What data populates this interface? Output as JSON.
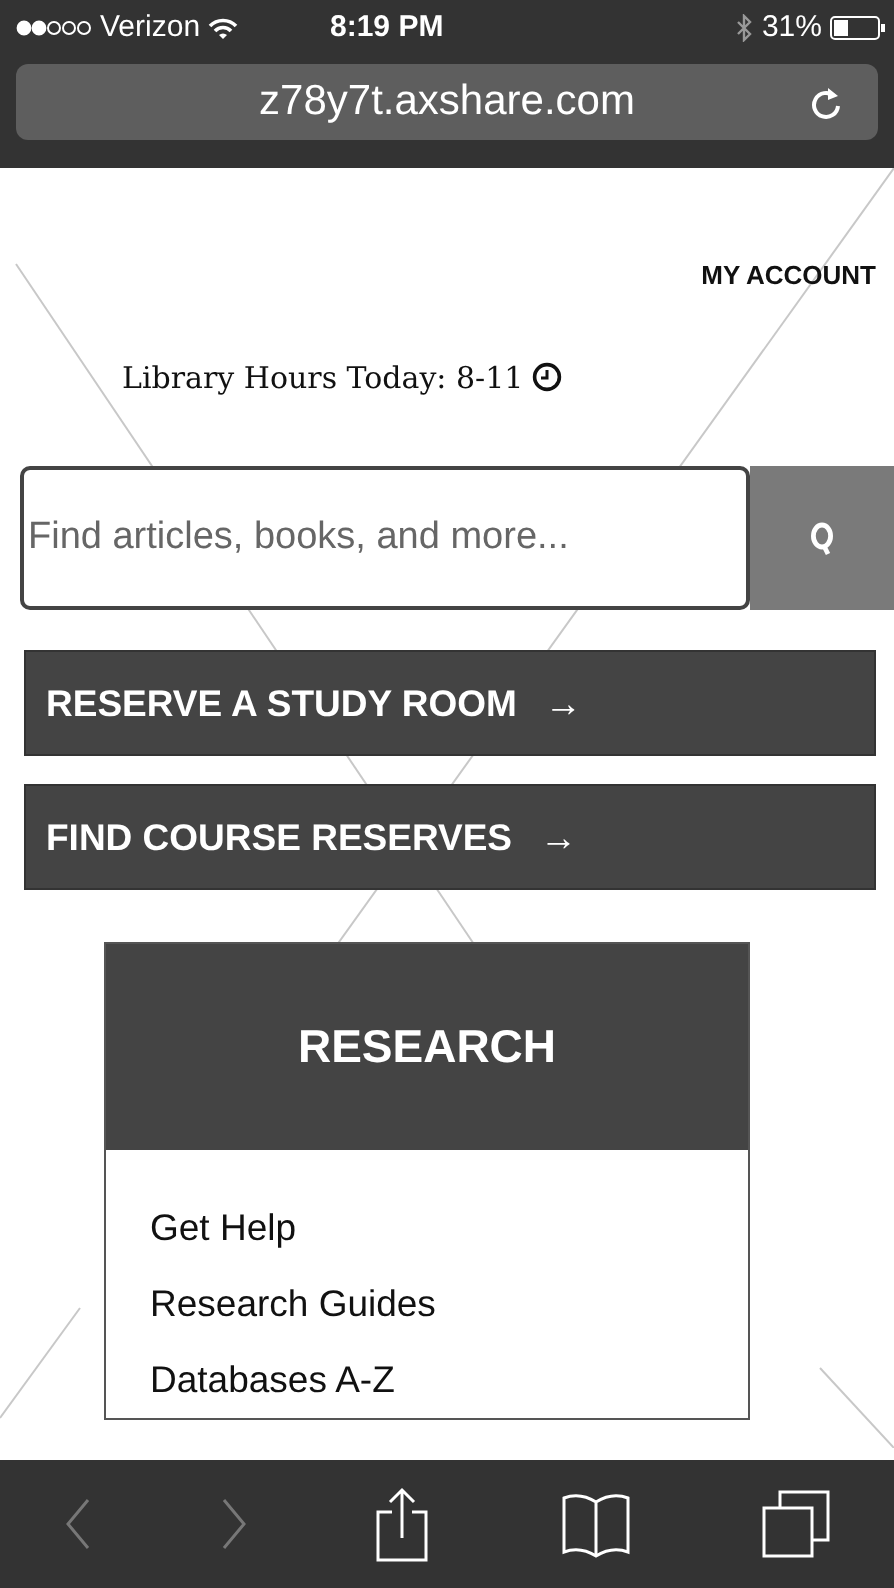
{
  "status_bar": {
    "carrier": "Verizon",
    "time": "8:19 PM",
    "battery": "31%"
  },
  "address_bar": {
    "url": "z78y7t.axshare.com"
  },
  "header": {
    "account_link": "MY ACCOUNT",
    "hours": "Library Hours Today: 8-11"
  },
  "search": {
    "placeholder": "Find articles, books, and more..."
  },
  "actions": [
    {
      "label": "RESERVE A STUDY ROOM",
      "arrow": "→"
    },
    {
      "label": "FIND COURSE RESERVES",
      "arrow": "→"
    }
  ],
  "research": {
    "title": "RESEARCH",
    "links": [
      "Get Help",
      "Research Guides",
      "Databases A-Z"
    ]
  },
  "toolbar": {
    "back_disabled": true,
    "forward_disabled": true
  }
}
